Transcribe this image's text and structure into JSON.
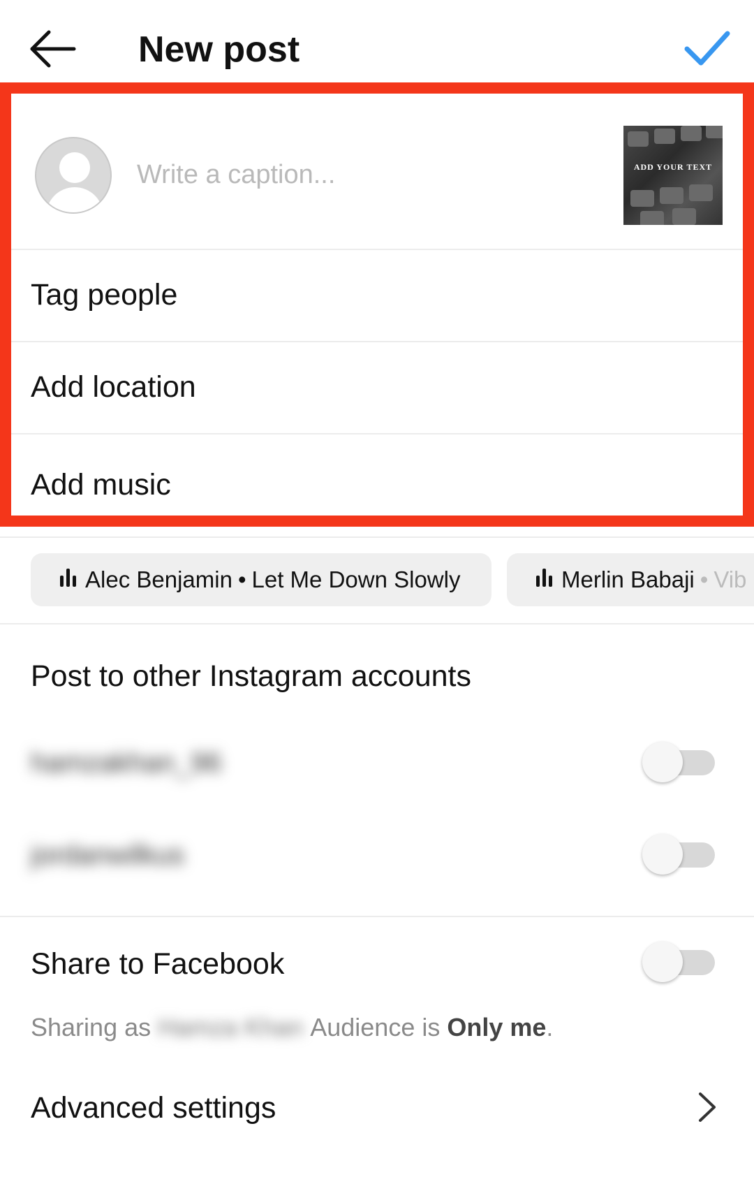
{
  "header": {
    "title": "New post",
    "back_icon": "arrow-left-icon",
    "confirm_icon": "checkmark-icon",
    "accent_color": "#3897f0"
  },
  "highlight_color": "#f4361a",
  "caption": {
    "placeholder": "Write a caption...",
    "value": "",
    "thumbnail_text": "ADD YOUR TEXT"
  },
  "options": {
    "tag_people": "Tag people",
    "add_location": "Add location",
    "add_music": "Add music"
  },
  "music_suggestions": [
    {
      "artist": "Alec Benjamin",
      "separator": "•",
      "song": "Let Me Down Slowly"
    },
    {
      "artist": "Merlin Babaji",
      "separator": "•",
      "song": "Vib"
    }
  ],
  "other_accounts": {
    "heading": "Post to other Instagram accounts",
    "accounts": [
      {
        "name": "hamzakhan_96",
        "enabled": false
      },
      {
        "name": "jordanwilkus",
        "enabled": false
      }
    ]
  },
  "facebook": {
    "label": "Share to Facebook",
    "enabled": false,
    "sharing_prefix": "Sharing as",
    "sharing_name": "Hamza Khan",
    "audience_prefix": "Audience is",
    "audience_value": "Only me",
    "audience_suffix": "."
  },
  "advanced": {
    "label": "Advanced settings",
    "icon": "chevron-right-icon"
  }
}
